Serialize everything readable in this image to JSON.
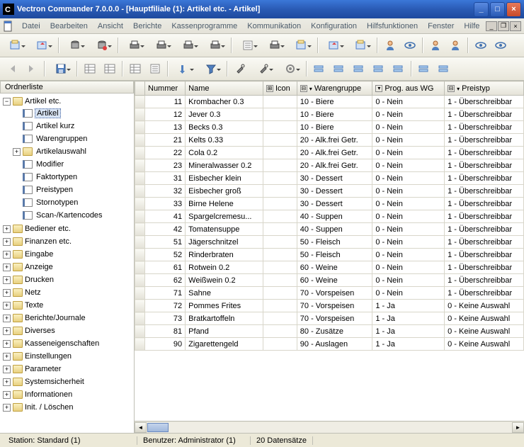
{
  "title": "Vectron Commander 7.0.0.0 - [Hauptfiliale (1): Artikel etc. - Artikel]",
  "menu": [
    "Datei",
    "Bearbeiten",
    "Ansicht",
    "Berichte",
    "Kassenprogramme",
    "Kommunikation",
    "Konfiguration",
    "Hilfsfunktionen",
    "Fenster",
    "Hilfe"
  ],
  "panel": "Ordnerliste",
  "tree": {
    "root": "Artikel etc.",
    "children": [
      {
        "label": "Artikel",
        "sel": true,
        "type": "doc"
      },
      {
        "label": "Artikel kurz",
        "type": "doc"
      },
      {
        "label": "Warengruppen",
        "type": "doc"
      },
      {
        "label": "Artikelauswahl",
        "type": "folder",
        "exp": "+"
      },
      {
        "label": "Modifier",
        "type": "doc"
      },
      {
        "label": "Faktortypen",
        "type": "doc"
      },
      {
        "label": "Preistypen",
        "type": "doc"
      },
      {
        "label": "Stornotypen",
        "type": "doc"
      },
      {
        "label": "Scan-/Kartencodes",
        "type": "doc"
      }
    ],
    "siblings": [
      "Bediener etc.",
      "Finanzen etc.",
      "Eingabe",
      "Anzeige",
      "Drucken",
      "Netz",
      "Texte",
      "Berichte/Journale",
      "Diverses",
      "Kasseneigenschaften",
      "Einstellungen",
      "Parameter",
      "Systemsicherheit",
      "Informationen",
      "Init. / Löschen"
    ]
  },
  "cols": [
    "Nummer",
    "Name",
    "Icon",
    "Warengruppe",
    "Prog. aus WG",
    "Preistyp"
  ],
  "rows": [
    {
      "n": 11,
      "name": "Krombacher 0.3",
      "wg": "10 - Biere",
      "p": "0 - Nein",
      "pt": "1 - Überschreibbar"
    },
    {
      "n": 12,
      "name": "Jever 0.3",
      "wg": "10 - Biere",
      "p": "0 - Nein",
      "pt": "1 - Überschreibbar"
    },
    {
      "n": 13,
      "name": "Becks 0.3",
      "wg": "10 - Biere",
      "p": "0 - Nein",
      "pt": "1 - Überschreibbar"
    },
    {
      "n": 21,
      "name": "Kelts 0.33",
      "wg": "20 - Alk.frei Getr.",
      "p": "0 - Nein",
      "pt": "1 - Überschreibbar"
    },
    {
      "n": 22,
      "name": "Cola 0.2",
      "wg": "20 - Alk.frei Getr.",
      "p": "0 - Nein",
      "pt": "1 - Überschreibbar"
    },
    {
      "n": 23,
      "name": "Mineralwasser 0.2",
      "wg": "20 - Alk.frei Getr.",
      "p": "0 - Nein",
      "pt": "1 - Überschreibbar"
    },
    {
      "n": 31,
      "name": "Eisbecher klein",
      "wg": "30 - Dessert",
      "p": "0 - Nein",
      "pt": "1 - Überschreibbar"
    },
    {
      "n": 32,
      "name": "Eisbecher groß",
      "wg": "30 - Dessert",
      "p": "0 - Nein",
      "pt": "1 - Überschreibbar"
    },
    {
      "n": 33,
      "name": "Birne Helene",
      "wg": "30 - Dessert",
      "p": "0 - Nein",
      "pt": "1 - Überschreibbar"
    },
    {
      "n": 41,
      "name": "Spargelcremesu...",
      "wg": "40 - Suppen",
      "p": "0 - Nein",
      "pt": "1 - Überschreibbar"
    },
    {
      "n": 42,
      "name": "Tomatensuppe",
      "wg": "40 - Suppen",
      "p": "0 - Nein",
      "pt": "1 - Überschreibbar"
    },
    {
      "n": 51,
      "name": "Jägerschnitzel",
      "wg": "50 - Fleisch",
      "p": "0 - Nein",
      "pt": "1 - Überschreibbar"
    },
    {
      "n": 52,
      "name": "Rinderbraten",
      "wg": "50 - Fleisch",
      "p": "0 - Nein",
      "pt": "1 - Überschreibbar"
    },
    {
      "n": 61,
      "name": "Rotwein 0.2",
      "wg": "60 - Weine",
      "p": "0 - Nein",
      "pt": "1 - Überschreibbar"
    },
    {
      "n": 62,
      "name": "Weißwein 0.2",
      "wg": "60 - Weine",
      "p": "0 - Nein",
      "pt": "1 - Überschreibbar"
    },
    {
      "n": 71,
      "name": "Sahne",
      "wg": "70 - Vorspeisen",
      "p": "0 - Nein",
      "pt": "1 - Überschreibbar"
    },
    {
      "n": 72,
      "name": "Pommes Frites",
      "wg": "70 - Vorspeisen",
      "p": "1 - Ja",
      "pt": "0 - Keine Auswahl"
    },
    {
      "n": 73,
      "name": "Bratkartoffeln",
      "wg": "70 - Vorspeisen",
      "p": "1 - Ja",
      "pt": "0 - Keine Auswahl"
    },
    {
      "n": 81,
      "name": "Pfand",
      "wg": "80 - Zusätze",
      "p": "1 - Ja",
      "pt": "0 - Keine Auswahl"
    },
    {
      "n": 90,
      "name": "Zigarettengeld",
      "wg": "90 - Auslagen",
      "p": "1 - Ja",
      "pt": "0 - Keine Auswahl"
    }
  ],
  "status": {
    "s1": "Station: Standard (1)",
    "s2": "Benutzer: Administrator (1)",
    "s3": "20 Datensätze"
  }
}
